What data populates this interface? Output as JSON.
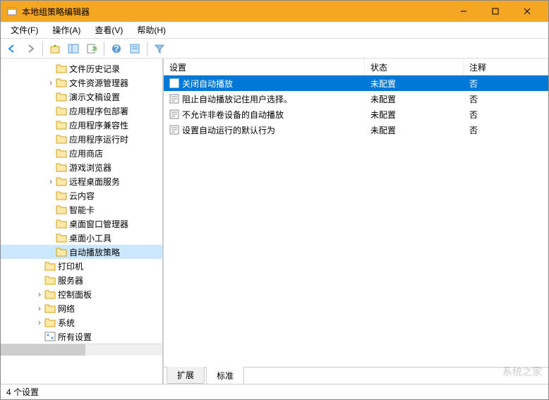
{
  "window": {
    "title": "本地组策略编辑器"
  },
  "menu": {
    "file": "文件(F)",
    "action": "操作(A)",
    "view": "查看(V)",
    "help": "帮助(H)"
  },
  "tree": {
    "items": [
      {
        "label": "文件历史记录",
        "indent": 4,
        "expandable": false
      },
      {
        "label": "文件资源管理器",
        "indent": 4,
        "expandable": true
      },
      {
        "label": "演示文稿设置",
        "indent": 4,
        "expandable": false
      },
      {
        "label": "应用程序包部署",
        "indent": 4,
        "expandable": false
      },
      {
        "label": "应用程序兼容性",
        "indent": 4,
        "expandable": false
      },
      {
        "label": "应用程序运行时",
        "indent": 4,
        "expandable": false
      },
      {
        "label": "应用商店",
        "indent": 4,
        "expandable": false
      },
      {
        "label": "游戏浏览器",
        "indent": 4,
        "expandable": false
      },
      {
        "label": "远程桌面服务",
        "indent": 4,
        "expandable": true
      },
      {
        "label": "云内容",
        "indent": 4,
        "expandable": false
      },
      {
        "label": "智能卡",
        "indent": 4,
        "expandable": false
      },
      {
        "label": "桌面窗口管理器",
        "indent": 4,
        "expandable": false
      },
      {
        "label": "桌面小工具",
        "indent": 4,
        "expandable": false
      },
      {
        "label": "自动播放策略",
        "indent": 4,
        "expandable": false,
        "selected": true
      },
      {
        "label": "打印机",
        "indent": 3,
        "expandable": false
      },
      {
        "label": "服务器",
        "indent": 3,
        "expandable": false
      },
      {
        "label": "控制面板",
        "indent": 3,
        "expandable": true
      },
      {
        "label": "网络",
        "indent": 3,
        "expandable": true
      },
      {
        "label": "系统",
        "indent": 3,
        "expandable": true
      },
      {
        "label": "所有设置",
        "indent": 3,
        "expandable": false,
        "special": true
      }
    ]
  },
  "list": {
    "columns": {
      "setting": "设置",
      "status": "状态",
      "comment": "注释"
    },
    "rows": [
      {
        "setting": "关闭自动播放",
        "status": "未配置",
        "comment": "否",
        "selected": true
      },
      {
        "setting": "阻止自动播放记住用户选择。",
        "status": "未配置",
        "comment": "否"
      },
      {
        "setting": "不允许非卷设备的自动播放",
        "status": "未配置",
        "comment": "否"
      },
      {
        "setting": "设置自动运行的默认行为",
        "status": "未配置",
        "comment": "否"
      }
    ]
  },
  "tabs": {
    "extended": "扩展",
    "standard": "标准"
  },
  "status": {
    "text": "4 个设置"
  },
  "watermark": "系统之家"
}
